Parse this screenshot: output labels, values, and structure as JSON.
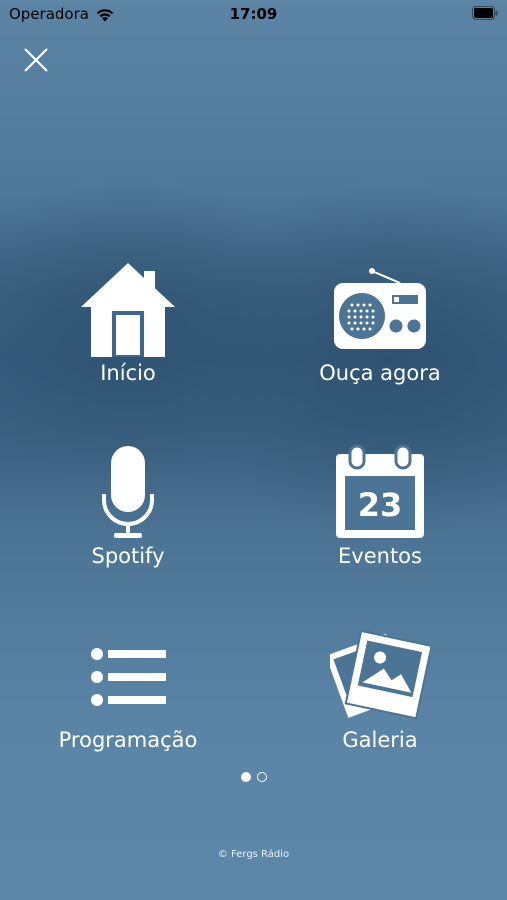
{
  "status_bar": {
    "carrier": "Operadora",
    "time": "17:09"
  },
  "menu": {
    "items": [
      {
        "label": "Início",
        "icon": "home-icon"
      },
      {
        "label": "Ouça agora",
        "icon": "radio-icon"
      },
      {
        "label": "Spotify",
        "icon": "microphone-icon"
      },
      {
        "label": "Eventos",
        "icon": "calendar-icon"
      },
      {
        "label": "Programação",
        "icon": "list-icon"
      },
      {
        "label": "Galeria",
        "icon": "photos-icon"
      }
    ],
    "calendar_day": "23"
  },
  "pager": {
    "pages": 2,
    "current": 1
  },
  "footer": {
    "copyright": "© Fergs Rádio"
  },
  "colors": {
    "background": "#577f9f",
    "foreground": "#ffffff",
    "status_text": "#000000"
  }
}
